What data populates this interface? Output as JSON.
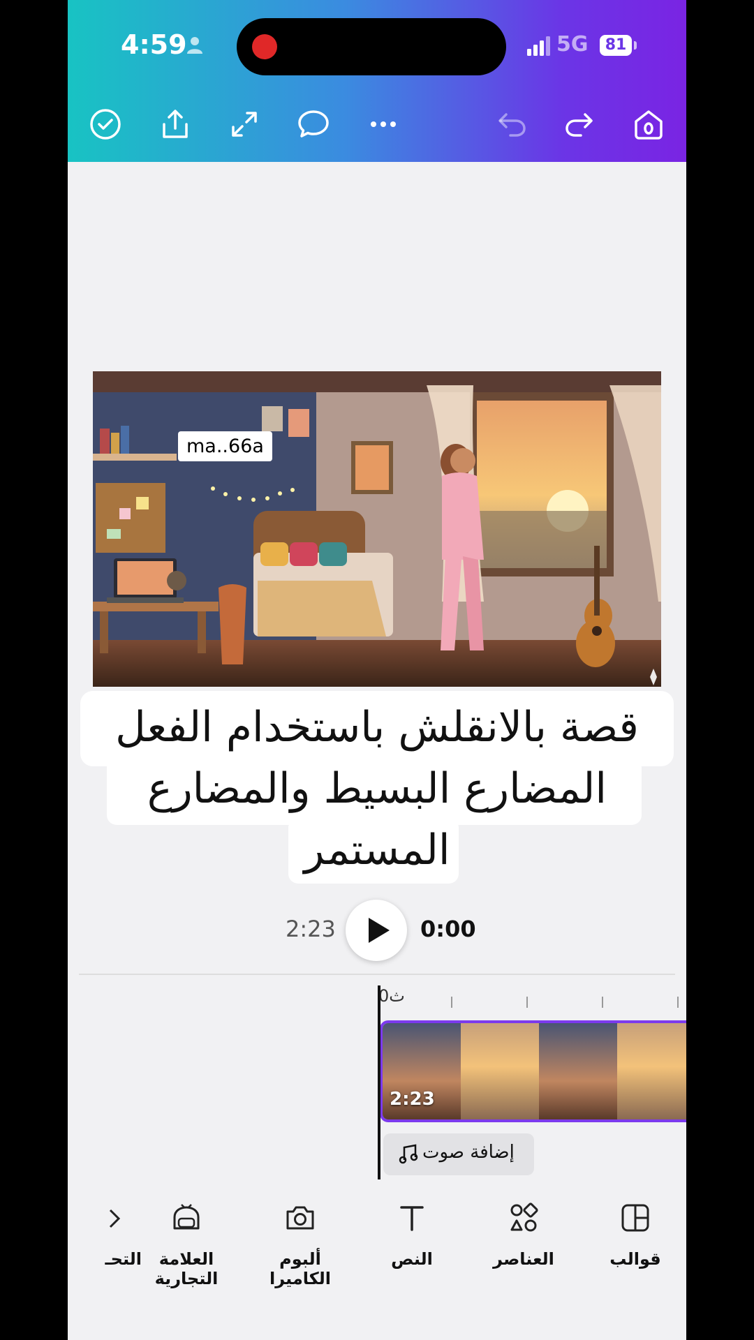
{
  "status_bar": {
    "time": "4:59",
    "network": "5G",
    "battery": "81"
  },
  "toolbar": {
    "icons": [
      "check-circle-icon",
      "share-icon",
      "expand-icon",
      "comment-icon",
      "more-icon",
      "undo-icon",
      "redo-icon",
      "home-icon"
    ]
  },
  "canvas": {
    "image_label": "ma..66a",
    "title_lines": [
      "قصة بالانقلش باستخدام الفعل",
      "المضارع البسيط والمضارع",
      "المستمر"
    ]
  },
  "playback": {
    "duration": "2:23",
    "current": "0:00"
  },
  "timeline": {
    "ruler_label": "0ث",
    "clip_duration": "2:23",
    "add_audio_label": "إضافة صوت"
  },
  "bottom_nav": {
    "items": [
      {
        "label": "قوالب",
        "icon": "templates-icon"
      },
      {
        "label": "العناصر",
        "icon": "elements-icon"
      },
      {
        "label": "النص",
        "icon": "text-icon"
      },
      {
        "label": "ألبوم الكاميرا",
        "icon": "camera-icon"
      },
      {
        "label": "العلامة التجارية",
        "icon": "brand-icon"
      },
      {
        "label": "التحـ",
        "icon": "partial-icon"
      }
    ]
  }
}
